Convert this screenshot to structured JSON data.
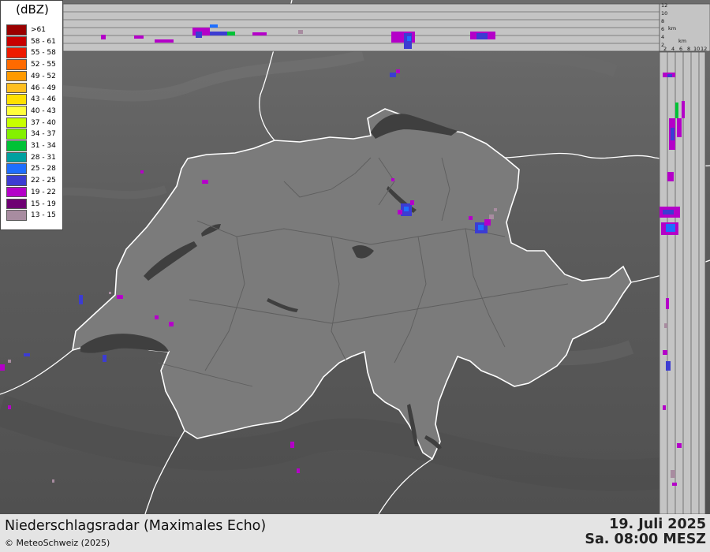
{
  "legend": {
    "unit": "(dBZ)",
    "classes": [
      {
        "label": ">61",
        "color": "#9b0000"
      },
      {
        "label": "58 - 61",
        "color": "#c80000"
      },
      {
        "label": "55 - 58",
        "color": "#ee1a00"
      },
      {
        "label": "52 - 55",
        "color": "#ff6a00"
      },
      {
        "label": "49 - 52",
        "color": "#ff9a00"
      },
      {
        "label": "46 - 49",
        "color": "#ffbf20"
      },
      {
        "label": "43 - 46",
        "color": "#ffe000"
      },
      {
        "label": "40 - 43",
        "color": "#ffff3c"
      },
      {
        "label": "37 - 40",
        "color": "#c8ff00"
      },
      {
        "label": "34 - 37",
        "color": "#84f000"
      },
      {
        "label": "31 - 34",
        "color": "#00c236"
      },
      {
        "label": "28 - 31",
        "color": "#00a0a0"
      },
      {
        "label": "25 - 28",
        "color": "#1e6eff"
      },
      {
        "label": "22 - 25",
        "color": "#3c3cd2"
      },
      {
        "label": "19 - 22",
        "color": "#b400c8"
      },
      {
        "label": "15 - 19",
        "color": "#6e0073"
      },
      {
        "label": "13 - 15",
        "color": "#a88ca0"
      }
    ]
  },
  "profile_axis": {
    "top_ticks": [
      "12",
      "10",
      "8",
      "6",
      "4",
      "2"
    ],
    "unit": "km",
    "right_ticks": [
      "2",
      "4",
      "6",
      "8",
      "10",
      "12"
    ]
  },
  "footer": {
    "title": "Niederschlagsradar (Maximales Echo)",
    "copyright": "© MeteoSchweiz (2025)",
    "date": "19. Juli 2025",
    "time": "Sa. 08:00 MESZ"
  },
  "colors": {
    "background_relief": "#5a5a5a",
    "swiss_territory": "#7b7b7b",
    "lakes": "#3f3f3f",
    "border_line": "#ffffff",
    "profile_panel": "#c4c4c4"
  }
}
